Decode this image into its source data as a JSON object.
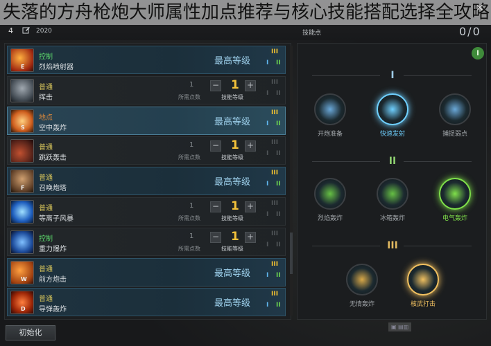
{
  "banner": {
    "title": "失落的方舟枪炮大师属性加点推荐与核心技能搭配选择全攻略"
  },
  "header": {
    "level": "4",
    "year": "2020",
    "points_label": "技能点",
    "points_count": "0/0",
    "close_glyph": "✕"
  },
  "common": {
    "max_level": "最高等级",
    "base_points_label": "所需点数",
    "skill_level_label": "技能等级",
    "minus": "−",
    "plus": "+",
    "tier_i": "I",
    "tier_ii": "II",
    "tier_iii": "III"
  },
  "skills": [
    {
      "type": "控制",
      "name": "烈焰喷射器",
      "hotkey": "E",
      "mode": "max",
      "base": "",
      "level": ""
    },
    {
      "type": "普通",
      "name": "挥击",
      "hotkey": "",
      "mode": "normal",
      "base": "1",
      "level": "1"
    },
    {
      "type": "地点",
      "name": "空中轰炸",
      "hotkey": "S",
      "mode": "max",
      "base": "",
      "level": ""
    },
    {
      "type": "普通",
      "name": "跳跃轰击",
      "hotkey": "",
      "mode": "normal",
      "base": "1",
      "level": "1"
    },
    {
      "type": "普通",
      "name": "召唤炮塔",
      "hotkey": "F",
      "mode": "max",
      "base": "",
      "level": ""
    },
    {
      "type": "普通",
      "name": "等离子风暴",
      "hotkey": "",
      "mode": "normal",
      "base": "1",
      "level": "1"
    },
    {
      "type": "控制",
      "name": "重力爆炸",
      "hotkey": "",
      "mode": "normal",
      "base": "1",
      "level": "1"
    },
    {
      "type": "普通",
      "name": "前方炮击",
      "hotkey": "W",
      "mode": "max",
      "base": "",
      "level": ""
    },
    {
      "type": "普通",
      "name": "导弹轰炸",
      "hotkey": "D",
      "mode": "max",
      "base": "",
      "level": ""
    }
  ],
  "reset_label": "初始化",
  "tripods": {
    "info_glyph": "i",
    "tier1": [
      {
        "name": "开炮准备",
        "selected": false,
        "color": "#6aa8d8"
      },
      {
        "name": "快速发射",
        "selected": true,
        "color": "#6fd0ff"
      },
      {
        "name": "捕捉弱点",
        "selected": false,
        "color": "#6aa8d8"
      }
    ],
    "tier2": [
      {
        "name": "烈焰轰炸",
        "selected": false,
        "color": "#66c044"
      },
      {
        "name": "冰箱轰炸",
        "selected": false,
        "color": "#66c044"
      },
      {
        "name": "电气轰炸",
        "selected": true,
        "color": "#7fe04a"
      }
    ],
    "tier3": [
      {
        "name": "无情轰炸",
        "selected": false,
        "color": "#d8a848"
      },
      {
        "name": "核武打击",
        "selected": true,
        "color": "#f0c060"
      }
    ]
  }
}
